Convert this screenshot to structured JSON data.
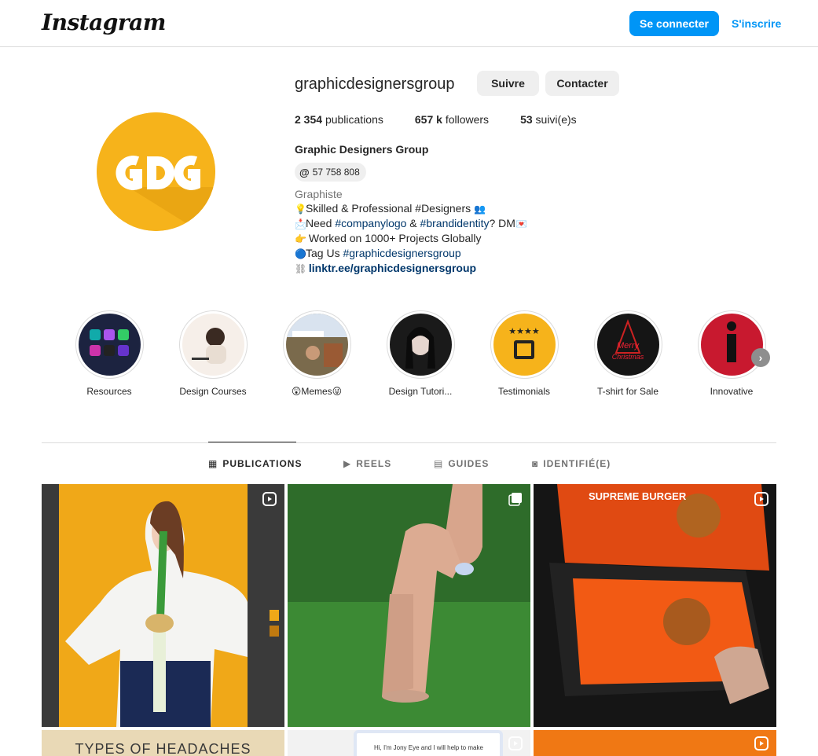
{
  "header": {
    "logo": "Instagram",
    "login_label": "Se connecter",
    "signup_label": "S'inscrire"
  },
  "profile": {
    "username": "graphicdesignersgroup",
    "follow_label": "Suivre",
    "contact_label": "Contacter",
    "stats": {
      "posts_count": "2 354",
      "posts_label": "publications",
      "followers_count": "657 k",
      "followers_label": "followers",
      "following_count": "53",
      "following_label": "suivi(e)s"
    },
    "full_name": "Graphic Designers Group",
    "threads_count": "57 758 808",
    "category": "Graphiste",
    "bio": {
      "line1_text": "Skilled & Professional #Designers",
      "line2_prefix": "Need ",
      "line2_tag1": "#companylogo",
      "line2_mid": " & ",
      "line2_tag2": "#brandidentity",
      "line2_suffix": "? DM",
      "line3_text": " Worked on 1000+ Projects Globally",
      "line4_prefix": "Tag Us ",
      "line4_tag": "#graphicdesignersgroup",
      "link": "linktr.ee/graphicdesignersgroup"
    },
    "avatar_text": "GDG"
  },
  "highlights": [
    {
      "label": "Resources"
    },
    {
      "label": "Design Courses"
    },
    {
      "label": "😲Memes😜"
    },
    {
      "label": "Design Tutori..."
    },
    {
      "label": "Testimonials"
    },
    {
      "label": "T-shirt for Sale"
    },
    {
      "label": "Innovative"
    }
  ],
  "tabs": [
    {
      "label": "PUBLICATIONS",
      "icon": "grid-icon"
    },
    {
      "label": "REELS",
      "icon": "reels-icon"
    },
    {
      "label": "GUIDES",
      "icon": "guides-icon"
    },
    {
      "label": "IDENTIFIÉ(E)",
      "icon": "tagged-icon"
    }
  ],
  "posts": [
    {
      "badge": "reel-icon",
      "text": ""
    },
    {
      "badge": "carousel-icon",
      "text": ""
    },
    {
      "badge": "reel-icon",
      "text": "SUPREME BURGER"
    },
    {
      "badge": "",
      "text": "TYPES OF HEADACHES"
    },
    {
      "badge": "reel-icon",
      "text": "Hi, I'm Jony Eye and I will help to make"
    },
    {
      "badge": "reel-icon",
      "text": ""
    }
  ],
  "colors": {
    "accent": "#0095f6",
    "avatar_bg": "#f6b31b",
    "link": "#00376b"
  }
}
